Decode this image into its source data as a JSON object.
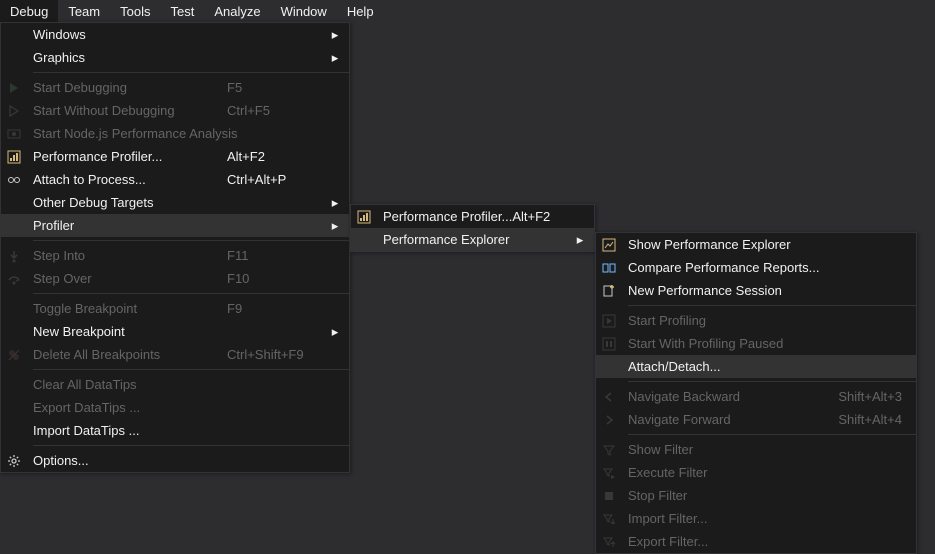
{
  "menubar": [
    "Debug",
    "Team",
    "Tools",
    "Test",
    "Analyze",
    "Window",
    "Help"
  ],
  "activeMenubarIndex": 0,
  "menu1": [
    {
      "type": "item",
      "label": "Windows",
      "shortcut": "",
      "submenu": true,
      "disabled": false,
      "icon": ""
    },
    {
      "type": "item",
      "label": "Graphics",
      "shortcut": "",
      "submenu": true,
      "disabled": false,
      "icon": ""
    },
    {
      "type": "sep"
    },
    {
      "type": "item",
      "label": "Start Debugging",
      "shortcut": "F5",
      "submenu": false,
      "disabled": true,
      "icon": "play"
    },
    {
      "type": "item",
      "label": "Start Without Debugging",
      "shortcut": "Ctrl+F5",
      "submenu": false,
      "disabled": true,
      "icon": "play-outline"
    },
    {
      "type": "item",
      "label": "Start Node.js Performance Analysis",
      "shortcut": "",
      "submenu": false,
      "disabled": true,
      "icon": "node"
    },
    {
      "type": "item",
      "label": "Performance Profiler...",
      "shortcut": "Alt+F2",
      "submenu": false,
      "disabled": false,
      "icon": "profiler"
    },
    {
      "type": "item",
      "label": "Attach to Process...",
      "shortcut": "Ctrl+Alt+P",
      "submenu": false,
      "disabled": false,
      "icon": "attach"
    },
    {
      "type": "item",
      "label": "Other Debug Targets",
      "shortcut": "",
      "submenu": true,
      "disabled": false,
      "icon": ""
    },
    {
      "type": "item",
      "label": "Profiler",
      "shortcut": "",
      "submenu": true,
      "disabled": false,
      "icon": "",
      "highlight": true
    },
    {
      "type": "sep"
    },
    {
      "type": "item",
      "label": "Step Into",
      "shortcut": "F11",
      "submenu": false,
      "disabled": true,
      "icon": "step-into"
    },
    {
      "type": "item",
      "label": "Step Over",
      "shortcut": "F10",
      "submenu": false,
      "disabled": true,
      "icon": "step-over"
    },
    {
      "type": "sep"
    },
    {
      "type": "item",
      "label": "Toggle Breakpoint",
      "shortcut": "F9",
      "submenu": false,
      "disabled": true,
      "icon": ""
    },
    {
      "type": "item",
      "label": "New Breakpoint",
      "shortcut": "",
      "submenu": true,
      "disabled": false,
      "icon": ""
    },
    {
      "type": "item",
      "label": "Delete All Breakpoints",
      "shortcut": "Ctrl+Shift+F9",
      "submenu": false,
      "disabled": true,
      "icon": "delete-bp"
    },
    {
      "type": "sep"
    },
    {
      "type": "item",
      "label": "Clear All DataTips",
      "shortcut": "",
      "submenu": false,
      "disabled": true,
      "icon": ""
    },
    {
      "type": "item",
      "label": "Export DataTips ...",
      "shortcut": "",
      "submenu": false,
      "disabled": true,
      "icon": ""
    },
    {
      "type": "item",
      "label": "Import DataTips ...",
      "shortcut": "",
      "submenu": false,
      "disabled": false,
      "icon": ""
    },
    {
      "type": "sep"
    },
    {
      "type": "item",
      "label": "Options...",
      "shortcut": "",
      "submenu": false,
      "disabled": false,
      "icon": "gear"
    }
  ],
  "menu2": [
    {
      "type": "item",
      "label": "Performance Profiler...",
      "shortcut": "Alt+F2",
      "submenu": false,
      "disabled": false,
      "icon": "profiler"
    },
    {
      "type": "item",
      "label": "Performance Explorer",
      "shortcut": "",
      "submenu": true,
      "disabled": false,
      "icon": "",
      "highlight": true
    }
  ],
  "menu3": [
    {
      "type": "item",
      "label": "Show Performance Explorer",
      "shortcut": "",
      "submenu": false,
      "disabled": false,
      "icon": "perf-explorer"
    },
    {
      "type": "item",
      "label": "Compare Performance Reports...",
      "shortcut": "",
      "submenu": false,
      "disabled": false,
      "icon": "compare"
    },
    {
      "type": "item",
      "label": "New Performance Session",
      "shortcut": "",
      "submenu": false,
      "disabled": false,
      "icon": "new-session"
    },
    {
      "type": "sep"
    },
    {
      "type": "item",
      "label": "Start Profiling",
      "shortcut": "",
      "submenu": false,
      "disabled": true,
      "icon": "start-prof"
    },
    {
      "type": "item",
      "label": "Start With Profiling Paused",
      "shortcut": "",
      "submenu": false,
      "disabled": true,
      "icon": "start-paused"
    },
    {
      "type": "item",
      "label": "Attach/Detach...",
      "shortcut": "",
      "submenu": false,
      "disabled": false,
      "icon": "",
      "highlight": true
    },
    {
      "type": "sep"
    },
    {
      "type": "item",
      "label": "Navigate Backward",
      "shortcut": "Shift+Alt+3",
      "submenu": false,
      "disabled": true,
      "icon": "nav-back"
    },
    {
      "type": "item",
      "label": "Navigate Forward",
      "shortcut": "Shift+Alt+4",
      "submenu": false,
      "disabled": true,
      "icon": "nav-fwd"
    },
    {
      "type": "sep"
    },
    {
      "type": "item",
      "label": "Show Filter",
      "shortcut": "",
      "submenu": false,
      "disabled": true,
      "icon": "filter"
    },
    {
      "type": "item",
      "label": "Execute Filter",
      "shortcut": "",
      "submenu": false,
      "disabled": true,
      "icon": "exec-filter"
    },
    {
      "type": "item",
      "label": "Stop Filter",
      "shortcut": "",
      "submenu": false,
      "disabled": true,
      "icon": "stop"
    },
    {
      "type": "item",
      "label": "Import Filter...",
      "shortcut": "",
      "submenu": false,
      "disabled": true,
      "icon": "import-filter"
    },
    {
      "type": "item",
      "label": "Export Filter...",
      "shortcut": "",
      "submenu": false,
      "disabled": true,
      "icon": "export-filter"
    }
  ]
}
